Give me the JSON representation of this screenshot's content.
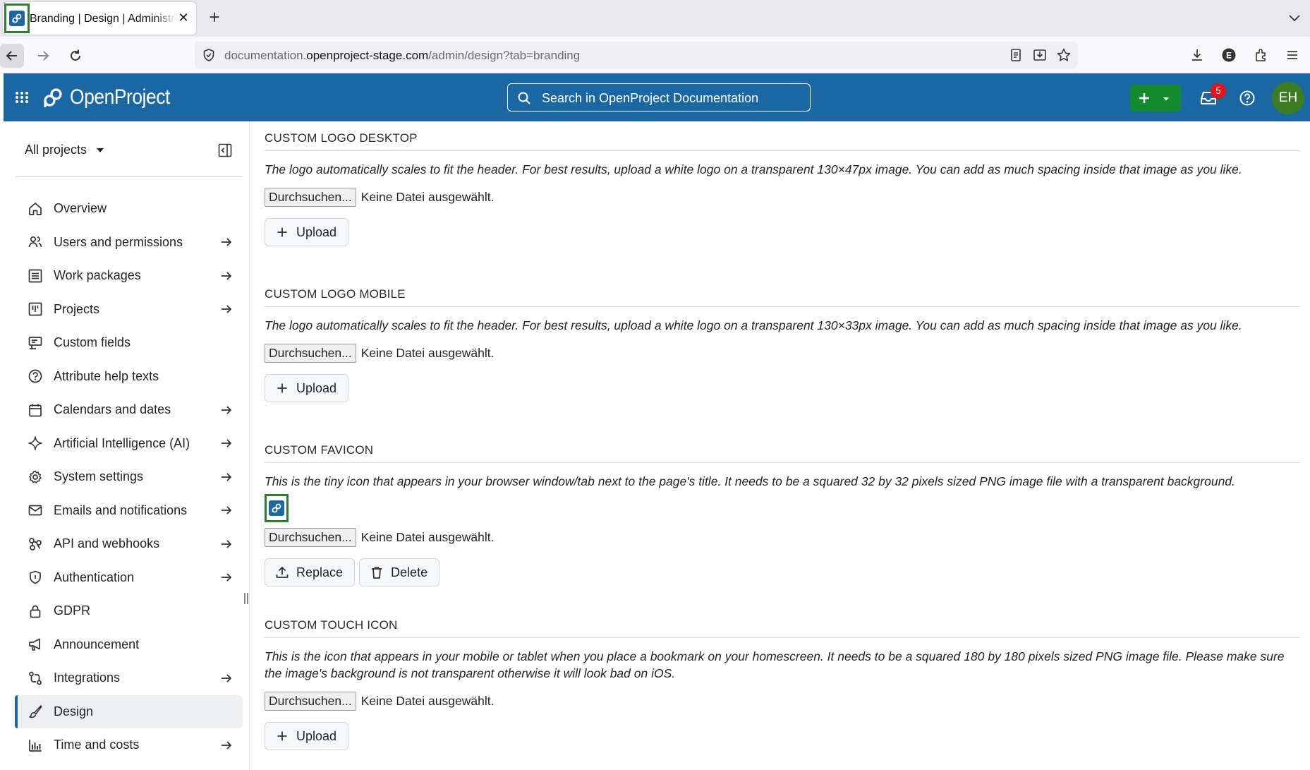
{
  "browser": {
    "tab_title": "Branding | Design | Administration",
    "url_prefix": "documentation.",
    "url_host": "openproject-stage.com",
    "url_path": "/admin/design?tab=branding"
  },
  "header": {
    "logo_text": "OpenProject",
    "search_placeholder": "Search in OpenProject Documentation",
    "notification_count": "5",
    "avatar_initials": "EH",
    "colors": {
      "header_bg": "#1a67a3",
      "create_btn": "#148a2f",
      "avatar_bg": "#3c7d23",
      "badge": "#e5141a"
    }
  },
  "sidebar": {
    "project_selector": "All projects",
    "items": [
      {
        "label": "Overview",
        "icon": "home-icon",
        "has_arrow": false
      },
      {
        "label": "Users and permissions",
        "icon": "people-icon",
        "has_arrow": true
      },
      {
        "label": "Work packages",
        "icon": "list-icon",
        "has_arrow": true
      },
      {
        "label": "Projects",
        "icon": "project-icon",
        "has_arrow": true
      },
      {
        "label": "Custom fields",
        "icon": "custom-fields-icon",
        "has_arrow": false
      },
      {
        "label": "Attribute help texts",
        "icon": "question-icon",
        "has_arrow": false
      },
      {
        "label": "Calendars and dates",
        "icon": "calendar-icon",
        "has_arrow": true
      },
      {
        "label": "Artificial Intelligence (AI)",
        "icon": "sparkle-icon",
        "has_arrow": true
      },
      {
        "label": "System settings",
        "icon": "gear-icon",
        "has_arrow": true
      },
      {
        "label": "Emails and notifications",
        "icon": "mail-icon",
        "has_arrow": true
      },
      {
        "label": "API and webhooks",
        "icon": "webhook-icon",
        "has_arrow": true
      },
      {
        "label": "Authentication",
        "icon": "shield-icon",
        "has_arrow": true
      },
      {
        "label": "GDPR",
        "icon": "lock-icon",
        "has_arrow": false
      },
      {
        "label": "Announcement",
        "icon": "megaphone-icon",
        "has_arrow": false
      },
      {
        "label": "Integrations",
        "icon": "integrations-icon",
        "has_arrow": true
      },
      {
        "label": "Design",
        "icon": "paintbrush-icon",
        "has_arrow": false,
        "active": true
      },
      {
        "label": "Time and costs",
        "icon": "graph-icon",
        "has_arrow": true
      }
    ]
  },
  "main": {
    "file_button": "Durchsuchen...",
    "no_file": "Keine Datei ausgewählt.",
    "upload_label": "Upload",
    "replace_label": "Replace",
    "delete_label": "Delete",
    "sections": {
      "logo_desktop": {
        "title": "CUSTOM LOGO DESKTOP",
        "description": "The logo automatically scales to fit the header. For best results, upload a white logo on a transparent 130×47px image. You can add as much spacing inside that image as you like."
      },
      "logo_mobile": {
        "title": "CUSTOM LOGO MOBILE",
        "description": "The logo automatically scales to fit the header. For best results, upload a white logo on a transparent 130×33px image. You can add as much spacing inside that image as you like."
      },
      "favicon": {
        "title": "CUSTOM FAVICON",
        "description": "This is the tiny icon that appears in your browser window/tab next to the page's title. It needs to be a squared 32 by 32 pixels sized PNG image file with a transparent background."
      },
      "touch_icon": {
        "title": "CUSTOM TOUCH ICON",
        "description": "This is the icon that appears in your mobile or tablet when you place a bookmark on your homescreen. It needs to be a squared 180 by 180 pixels sized PNG image file. Please make sure the image's background is not transparent otherwise it will look bad on iOS."
      }
    }
  }
}
